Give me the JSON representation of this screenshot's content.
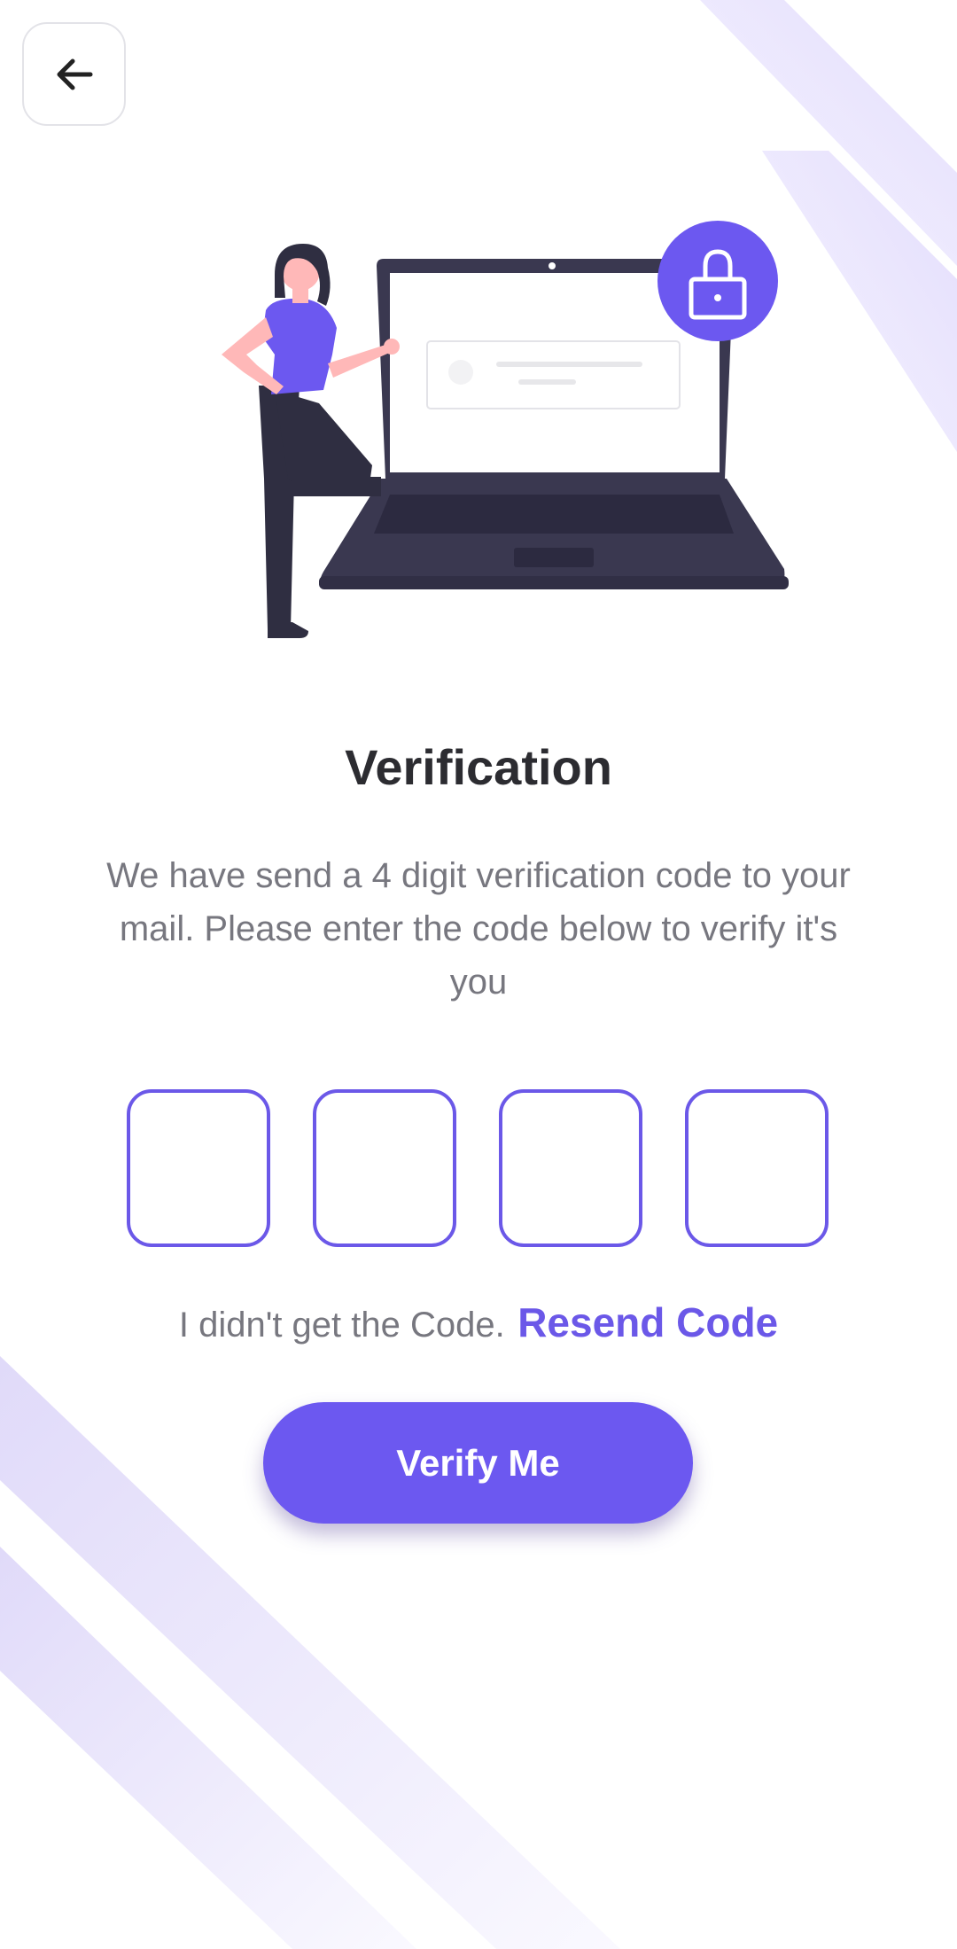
{
  "colors": {
    "accent": "#6c58f0",
    "accent_light": "#e5e0fc",
    "figure_dark": "#3a3850",
    "text_dark": "#2c2c31",
    "text_muted": "#77777f"
  },
  "header": {
    "back_icon": "arrow-left-icon"
  },
  "hero": {
    "illustration": "person-with-laptop-illustration",
    "lock_icon": "lock-icon"
  },
  "verification": {
    "title": "Verification",
    "description": "We have send a 4 digit verification code to your mail. Please enter the code below to verify it's you",
    "code_digits": [
      "",
      "",
      "",
      ""
    ],
    "resend_prompt": "I didn't get the Code.",
    "resend_label": "Resend Code",
    "verify_label": "Verify Me"
  }
}
